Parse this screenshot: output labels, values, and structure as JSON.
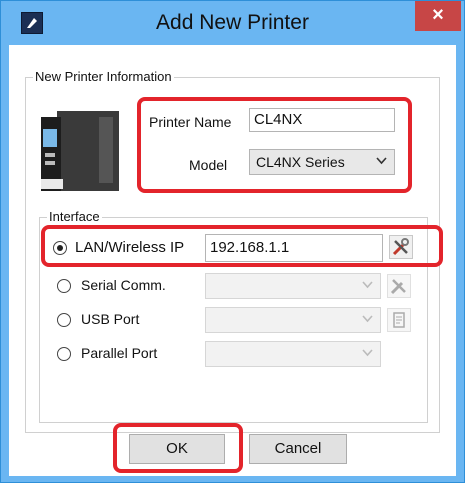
{
  "window": {
    "title": "Add New Printer",
    "close_glyph": "×",
    "accent": "#6ab6f2",
    "highlight": "#e3242b"
  },
  "info_group": {
    "label": "New Printer Information"
  },
  "printer_name": {
    "label": "Printer Name",
    "value": "CL4NX"
  },
  "model": {
    "label": "Model",
    "value": "CL4NX Series"
  },
  "interface_group": {
    "label": "Interface"
  },
  "interfaces": [
    {
      "label": "LAN/Wireless IP",
      "selected": true,
      "value": "192.168.1.1",
      "icon": "tools-icon"
    },
    {
      "label": "Serial Comm.",
      "selected": false,
      "icon": "tools-icon"
    },
    {
      "label": "USB Port",
      "selected": false,
      "icon": "document-icon"
    },
    {
      "label": "Parallel Port",
      "selected": false
    }
  ],
  "buttons": {
    "ok": "OK",
    "cancel": "Cancel"
  }
}
